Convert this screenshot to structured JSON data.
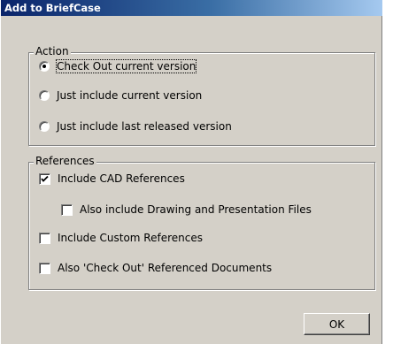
{
  "window": {
    "title": "Add to BriefCase"
  },
  "action_group": {
    "legend": "Action",
    "options": [
      {
        "label": "Check Out current version",
        "selected": true
      },
      {
        "label": "Just include current version",
        "selected": false
      },
      {
        "label": "Just include last released version",
        "selected": false
      }
    ]
  },
  "references_group": {
    "legend": "References",
    "options": [
      {
        "label": "Include CAD References",
        "checked": true
      },
      {
        "label": "Also include Drawing and Presentation Files",
        "checked": false
      },
      {
        "label": "Include Custom References",
        "checked": false
      },
      {
        "label": "Also 'Check Out' Referenced Documents",
        "checked": false
      }
    ]
  },
  "buttons": {
    "ok_label": "OK"
  }
}
